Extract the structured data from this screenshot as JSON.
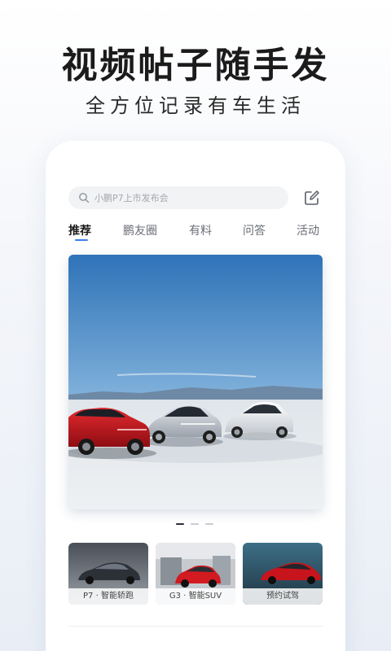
{
  "promo": {
    "headline": "视频帖子随手发",
    "subline": "全方位记录有车生活"
  },
  "search": {
    "placeholder": "小鹏P7上市发布会",
    "icon": "search-icon"
  },
  "toolbar": {
    "edit_icon": "edit-icon"
  },
  "tabs": [
    {
      "label": "推荐",
      "active": true
    },
    {
      "label": "鹏友圈",
      "active": false
    },
    {
      "label": "有料",
      "active": false
    },
    {
      "label": "问答",
      "active": false
    },
    {
      "label": "活动",
      "active": false
    }
  ],
  "carousel": {
    "slide_count": 3,
    "active_index": 0
  },
  "cards": [
    {
      "label": "P7 · 智能轿跑"
    },
    {
      "label": "G3 · 智能SUV"
    },
    {
      "label": "预约试驾"
    }
  ],
  "colors": {
    "accent": "#3b7df0",
    "car_red": "#c8141c",
    "car_silver": "#c9ced6",
    "car_white": "#f2f4f6"
  }
}
